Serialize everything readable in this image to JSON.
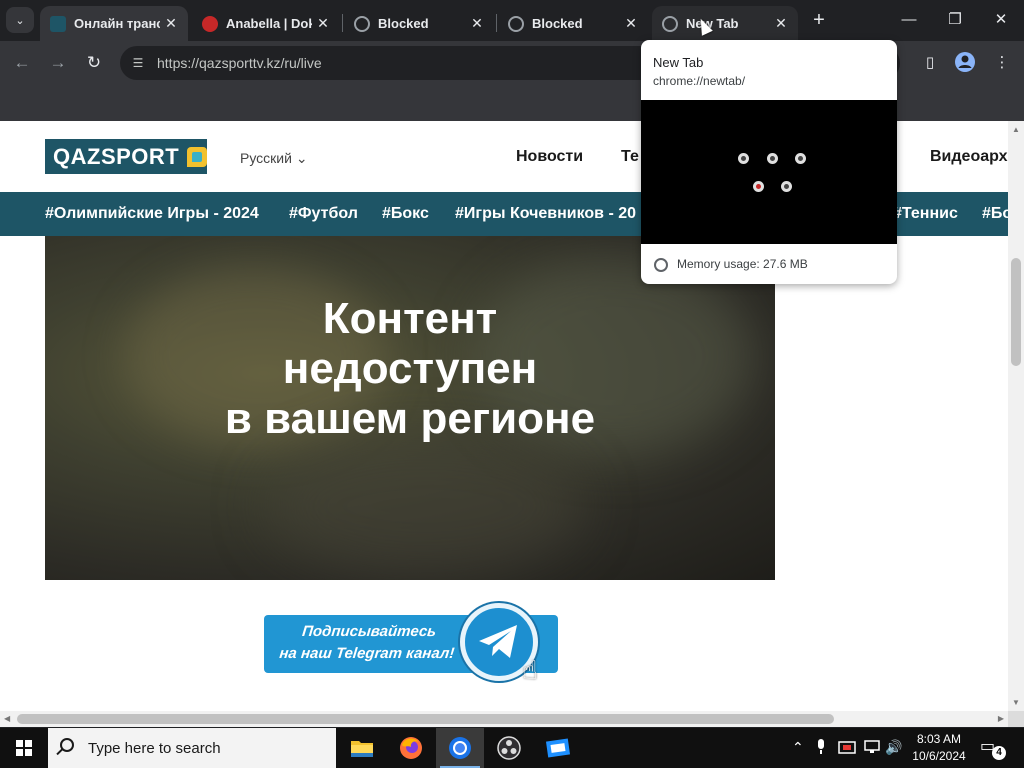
{
  "browser": {
    "tabs": [
      {
        "title": "Онлайн трансл",
        "favicon": "qazsport-favicon",
        "active": true
      },
      {
        "title": "Anabella | Dok",
        "favicon": "anabella-favicon",
        "active": false
      },
      {
        "title": "Blocked",
        "favicon": "globe-icon",
        "active": false
      },
      {
        "title": "Blocked",
        "favicon": "globe-icon",
        "active": false
      },
      {
        "title": "New Tab",
        "favicon": "globe-icon",
        "active": false,
        "hovered": true
      }
    ],
    "new_tab_symbol": "+",
    "window_controls": {
      "minimize": "—",
      "maximize": "❐",
      "close": "✕"
    },
    "url": "https://qazsporttv.kz/ru/live"
  },
  "hover_card": {
    "title": "New Tab",
    "url": "chrome://newtab/",
    "memory": "Memory usage: 27.6 MB"
  },
  "site": {
    "logo_text": "QAZSPORT",
    "language": "Русский",
    "nav": [
      "Новости",
      "Те",
      "Видеоарх"
    ],
    "hashtags": [
      "#Олимпийские Игры - 2024",
      "#Футбол",
      "#Бокс",
      "#Игры Кочевников - 20",
      "#Теннис",
      "#Бо"
    ],
    "blocked_message": [
      "Контент",
      "недоступен",
      "в вашем регионе"
    ],
    "telegram_banner": [
      "Подписывайтесь",
      "на наш Telegram канал!"
    ]
  },
  "taskbar": {
    "search_placeholder": "Type here to search",
    "time": "8:03 AM",
    "date": "10/6/2024",
    "notification_count": "4"
  },
  "colors": {
    "brand": "#1e5566",
    "telegram": "#2196d3",
    "chrome_dark": "#202124",
    "chrome_toolbar": "#35363a"
  }
}
